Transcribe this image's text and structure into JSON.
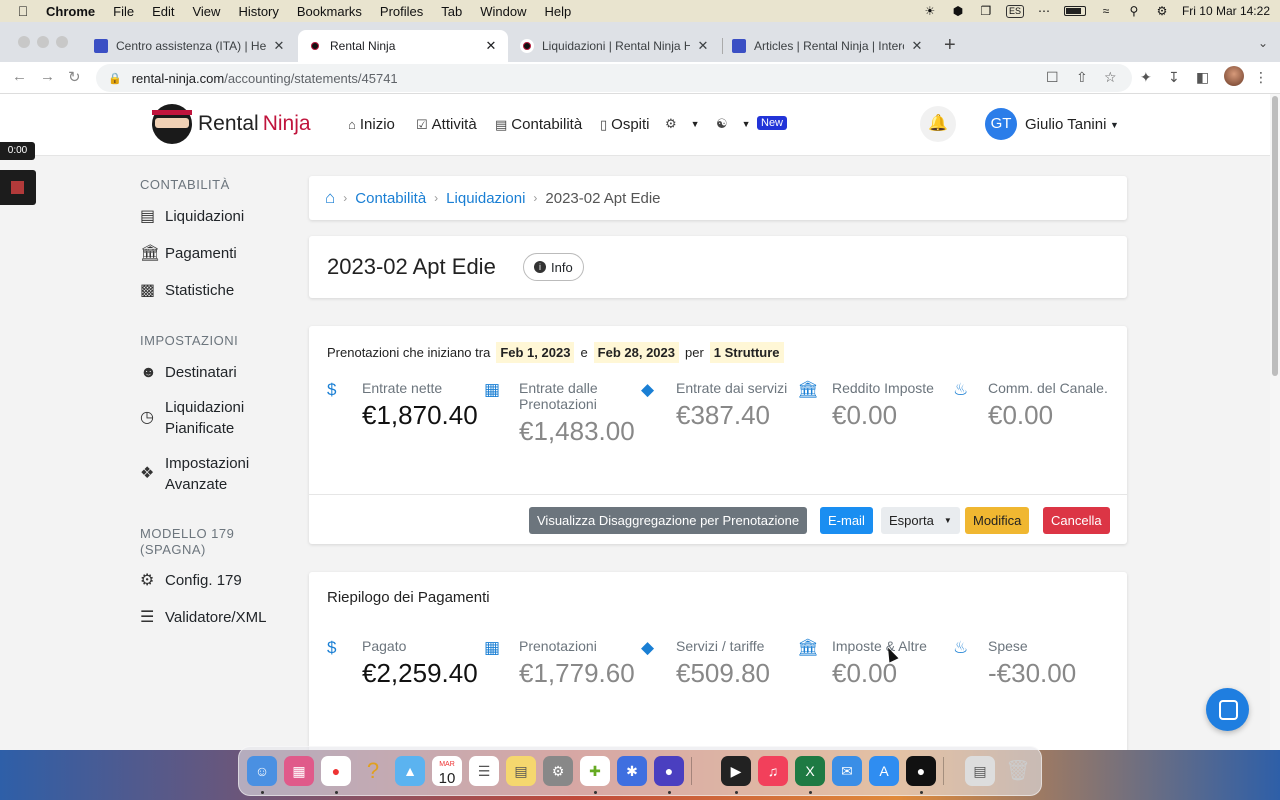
{
  "menubar": {
    "app": "Chrome",
    "items": [
      "File",
      "Edit",
      "View",
      "History",
      "Bookmarks",
      "Profiles",
      "Tab",
      "Window",
      "Help"
    ],
    "keyboard": "ES",
    "clock": "Fri 10 Mar  14:22"
  },
  "tabs": [
    {
      "title": "Centro assistenza (ITA) | Help C",
      "icon": "intercom-icon"
    },
    {
      "title": "Rental Ninja",
      "icon": "ninja-icon",
      "active": true
    },
    {
      "title": "Liquidazioni | Rental Ninja Help",
      "icon": "ninja-icon"
    },
    {
      "title": "Articles | Rental Ninja | Intercom",
      "icon": "intercom-icon"
    }
  ],
  "address": {
    "domain": "rental-ninja.com",
    "path": "/accounting/statements/45741"
  },
  "header": {
    "logo_word1": "Rental",
    "logo_word2": "Ninja",
    "nav": {
      "inizio": "Inizio",
      "attivita": "Attività",
      "contabilita": "Contabilità",
      "ospiti": "Ospiti"
    },
    "new_badge": "New",
    "user_initials": "GT",
    "user_name": "Giulio Tanini"
  },
  "sidebar": {
    "section1": "CONTABILITÀ",
    "liquidazioni": "Liquidazioni",
    "pagamenti": "Pagamenti",
    "statistiche": "Statistiche",
    "section2": "IMPOSTAZIONI",
    "destinatari": "Destinatari",
    "liq_pian_1": "Liquidazioni",
    "liq_pian_2": "Pianificate",
    "imp_av_1": "Impostazioni",
    "imp_av_2": "Avanzate",
    "section3_1": "MODELLO 179",
    "section3_2": "(SPAGNA)",
    "config": "Config. 179",
    "validatore": "Validatore/XML"
  },
  "recorder": {
    "time": "0:00"
  },
  "breadcrumb": {
    "level1": "Contabilità",
    "level2": "Liquidazioni",
    "current": "2023-02 Apt Edie"
  },
  "title": {
    "text": "2023-02 Apt Edie",
    "info": "Info"
  },
  "summary": {
    "filter_prefix": "Prenotazioni che iniziano tra",
    "date_from": "Feb 1, 2023",
    "and": "e",
    "date_to": "Feb 28, 2023",
    "per": "per",
    "properties": "1 Strutture",
    "stats": {
      "s0": {
        "label": "Entrate nette",
        "value": "€1,870.40"
      },
      "s1": {
        "label": "Entrate dalle Prenotazioni",
        "value": "€1,483.00"
      },
      "s2": {
        "label": "Entrate dai servizi",
        "value": "€387.40"
      },
      "s3": {
        "label": "Reddito Imposte",
        "value": "€0.00"
      },
      "s4": {
        "label": "Comm. del Canale.",
        "value": "€0.00"
      }
    },
    "actions": {
      "visualizza": "Visualizza Disaggregazione per Prenotazione",
      "email": "E-mail",
      "esporta": "Esporta",
      "modifica": "Modifica",
      "cancella": "Cancella"
    }
  },
  "payments": {
    "title": "Riepilogo dei Pagamenti",
    "stats": {
      "s0": {
        "label": "Pagato",
        "value": "€2,259.40"
      },
      "s1": {
        "label": "Prenotazioni",
        "value": "€1,779.60"
      },
      "s2": {
        "label": "Servizi / tariffe",
        "value": "€509.80"
      },
      "s3": {
        "label": "Imposte & Altre",
        "value": "€0.00"
      },
      "s4": {
        "label": "Spese",
        "value": "-€30.00"
      }
    }
  },
  "dock_calendar": {
    "month": "MAR",
    "day": "10"
  },
  "colors": {
    "accent": "#1a7fd4",
    "brand": "#c0143c",
    "danger": "#dc3545",
    "warning": "#f0b731",
    "secondary": "#6c757d"
  }
}
